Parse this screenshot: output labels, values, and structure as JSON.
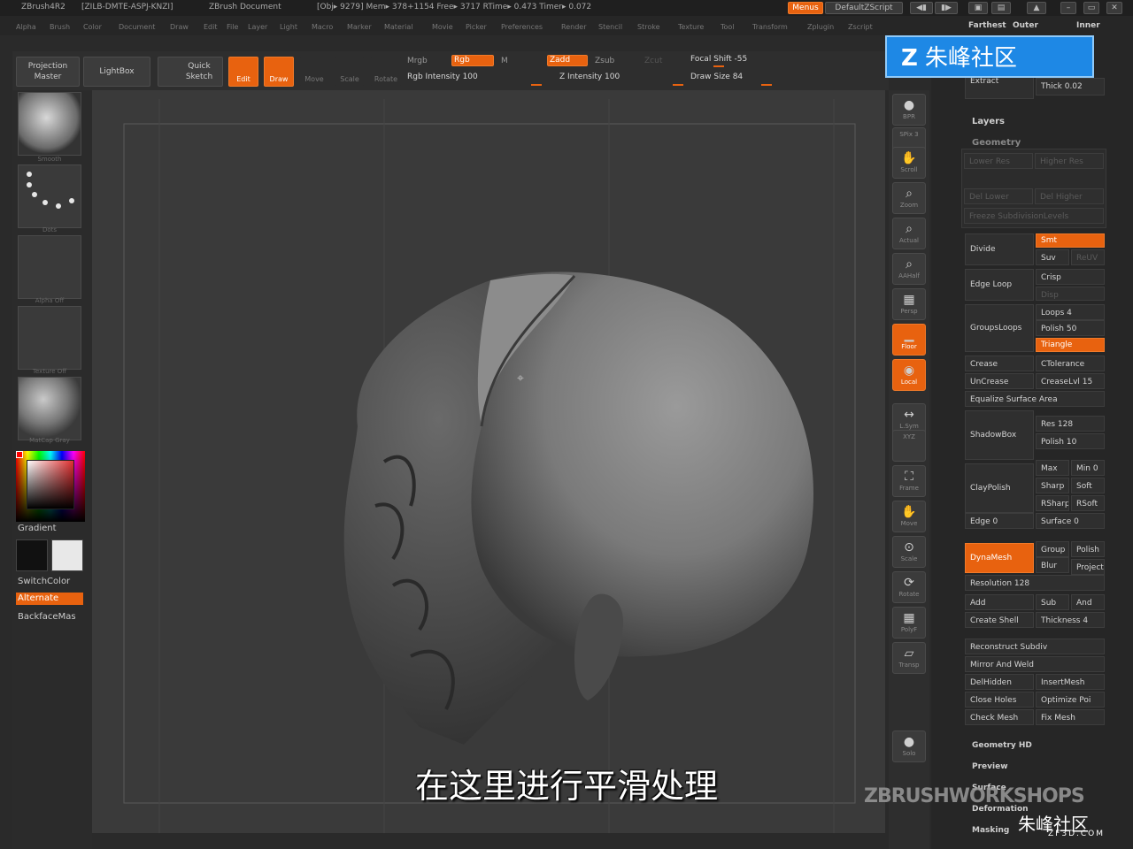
{
  "titlebar": {
    "app": "ZBrush4R2",
    "code": "[ZILB-DMTE-ASPJ-KNZI]",
    "doc": "ZBrush Document",
    "stats": "[Obj▸ 9279] Mem▸ 378+1154 Free▸ 3717 RTime▸ 0.473 Timer▸ 0.072",
    "menus_btn": "Menus",
    "script_btn": "DefaultZScript"
  },
  "menubar": [
    "Alpha",
    "Brush",
    "Color",
    "Document",
    "Draw",
    "Edit",
    "File",
    "Layer",
    "Light",
    "Macro",
    "Marker",
    "Material",
    "Movie",
    "Picker",
    "Preferences",
    "Render",
    "Stencil",
    "Stroke",
    "Texture",
    "Tool",
    "Transform",
    "Zplugin",
    "Zscript"
  ],
  "topshelf": {
    "projection_master": [
      "Projection",
      "Master"
    ],
    "lightbox": "LightBox",
    "quick_sketch": [
      "Quick",
      "Sketch"
    ],
    "edit": "Edit",
    "draw": "Draw",
    "move": "Move",
    "scale": "Scale",
    "rotate": "Rotate",
    "mrgb": "Mrgb",
    "rgb": "Rgb",
    "m": "M",
    "rgb_intensity": "Rgb Intensity 100",
    "zadd": "Zadd",
    "zsub": "Zsub",
    "zcut": "Zcut",
    "z_intensity": "Z Intensity 100",
    "focal_shift": "Focal Shift -55",
    "draw_size": "Draw Size 84"
  },
  "leftshelf": {
    "brush_caption": "Smooth",
    "stroke_caption": "Dots",
    "alpha_caption": "Alpha Off",
    "texture_caption": "Texture Off",
    "material_caption": "MatCap Gray",
    "gradient": "Gradient",
    "switchcolor": "SwitchColor",
    "alternate": "Alternate",
    "backface": "BackfaceMas"
  },
  "rightshelf": [
    {
      "name": "bpr",
      "label": "BPR",
      "icon": "●"
    },
    {
      "name": "spix",
      "label": "SPix 3",
      "icon": ""
    },
    {
      "name": "scroll",
      "label": "Scroll",
      "icon": "✋"
    },
    {
      "name": "zoom",
      "label": "Zoom",
      "icon": "⌕"
    },
    {
      "name": "actual",
      "label": "Actual",
      "icon": "⌕"
    },
    {
      "name": "aahalf",
      "label": "AAHalf",
      "icon": "⌕"
    },
    {
      "name": "persp",
      "label": "Persp",
      "icon": "▦"
    },
    {
      "name": "floor",
      "label": "Floor",
      "icon": "▁"
    },
    {
      "name": "local",
      "label": "Local",
      "icon": "◉"
    },
    {
      "name": "lsym",
      "label": "L.Sym",
      "icon": "↔"
    },
    {
      "name": "xyz",
      "label": "XYZ",
      "icon": ""
    },
    {
      "name": "frame",
      "label": "Frame",
      "icon": "⛶"
    },
    {
      "name": "move",
      "label": "Move",
      "icon": "✋"
    },
    {
      "name": "scale",
      "label": "Scale",
      "icon": "⊙"
    },
    {
      "name": "rotate",
      "label": "Rotate",
      "icon": "⟳"
    },
    {
      "name": "polyf",
      "label": "PolyF",
      "icon": "▦"
    },
    {
      "name": "transp",
      "label": "Transp",
      "icon": "▱"
    },
    {
      "name": "solo",
      "label": "Solo",
      "icon": "●"
    }
  ],
  "panel": {
    "farthest": "Farthest",
    "outer": "Outer",
    "inner": "Inner",
    "extract": "Extract",
    "thick": "Thick 0.02",
    "layers": "Layers",
    "geometry": "Geometry",
    "ghost": [
      "Lower Res",
      "Higher Res",
      "Del Lower",
      "Del Higher",
      "Freeze SubdivisionLevels"
    ],
    "divide": "Divide",
    "smt": "Smt",
    "suv": "Suv",
    "rsmt": "ReUV",
    "edge_loop": "Edge Loop",
    "crisp": "Crisp",
    "disp": "Disp",
    "groupsloops": "GroupsLoops",
    "loops": "Loops 4",
    "polish": "Polish 50",
    "triangle": "Triangle",
    "crease": "Crease",
    "ctolerance": "CTolerance",
    "uncrease": "UnCrease",
    "creaselvl": "CreaseLvl 15",
    "equalize": "Equalize Surface Area",
    "shadowbox": "ShadowBox",
    "res": "Res 128",
    "polish10": "Polish 10",
    "claypolish": "ClayPolish",
    "max": "Max",
    "min": "Min 0",
    "sharp": "Sharp",
    "soft": "Soft",
    "rsharp": "RSharp",
    "rsoft": "RSoft",
    "edge": "Edge 0",
    "surface": "Surface 0",
    "dynamesh": "DynaMesh",
    "group": "Group",
    "polish_b": "Polish",
    "blur": "Blur",
    "project": "Project",
    "resolution": "Resolution 128",
    "add": "Add",
    "sub": "Sub",
    "and": "And",
    "create_shell": "Create Shell",
    "thickness": "Thickness 4",
    "reconstruct": "Reconstruct Subdiv",
    "mirror": "Mirror And Weld",
    "delhidden": "DelHidden",
    "insertmesh": "InsertMesh",
    "closeholes": "Close Holes",
    "optimize": "Optimize Poi",
    "checkmesh": "Check Mesh",
    "fixmesh": "Fix Mesh",
    "geometry_hd": "Geometry HD",
    "preview": "Preview",
    "surface_h": "Surface",
    "deformation": "Deformation",
    "masking": "Masking"
  },
  "overlay": {
    "watermark_top": "朱峰社区",
    "subtitle": "在这里进行平滑处理",
    "zbrush_workshops": "ZBRUSHWORKSHOPS",
    "zf3d": "朱峰社区",
    "zf3d_url": "ZF3D.COM"
  },
  "colors": {
    "accent": "#e8620f",
    "panel": "#262626",
    "canvas": "#3a3a3a"
  }
}
